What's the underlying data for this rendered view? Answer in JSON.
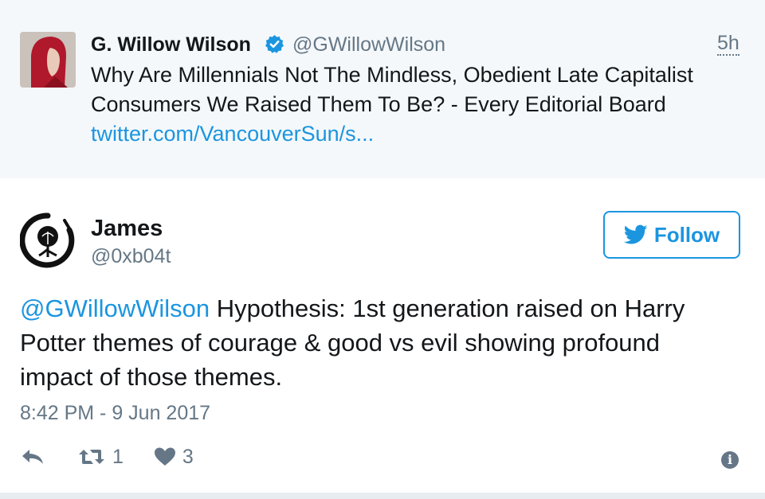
{
  "parent_tweet": {
    "name": "G. Willow Wilson",
    "handle": "@GWillowWilson",
    "time": "5h",
    "text_line1": "Why Are Millennials Not The Mindless, Obedient Late Capitalist",
    "text_line2": "Consumers We Raised Them To Be? - Every Editorial Board",
    "link": "twitter.com/VancouverSun/s..."
  },
  "tweet": {
    "name": "James",
    "handle": "@0xb04t",
    "follow_label": "Follow",
    "mention": "@GWillowWilson",
    "text": " Hypothesis: 1st generation raised on Harry Potter themes of courage & good vs evil showing profound impact of those themes.",
    "timestamp": "8:42 PM - 9 Jun 2017",
    "retweet_count": "1",
    "like_count": "3"
  },
  "colors": {
    "link_blue": "#1b95e0",
    "secondary_gray": "#657786",
    "parent_background": "#f5f8fa"
  },
  "icons": [
    "verified-badge-icon",
    "twitter-bird-icon",
    "reply-icon",
    "retweet-icon",
    "heart-icon",
    "info-icon"
  ]
}
